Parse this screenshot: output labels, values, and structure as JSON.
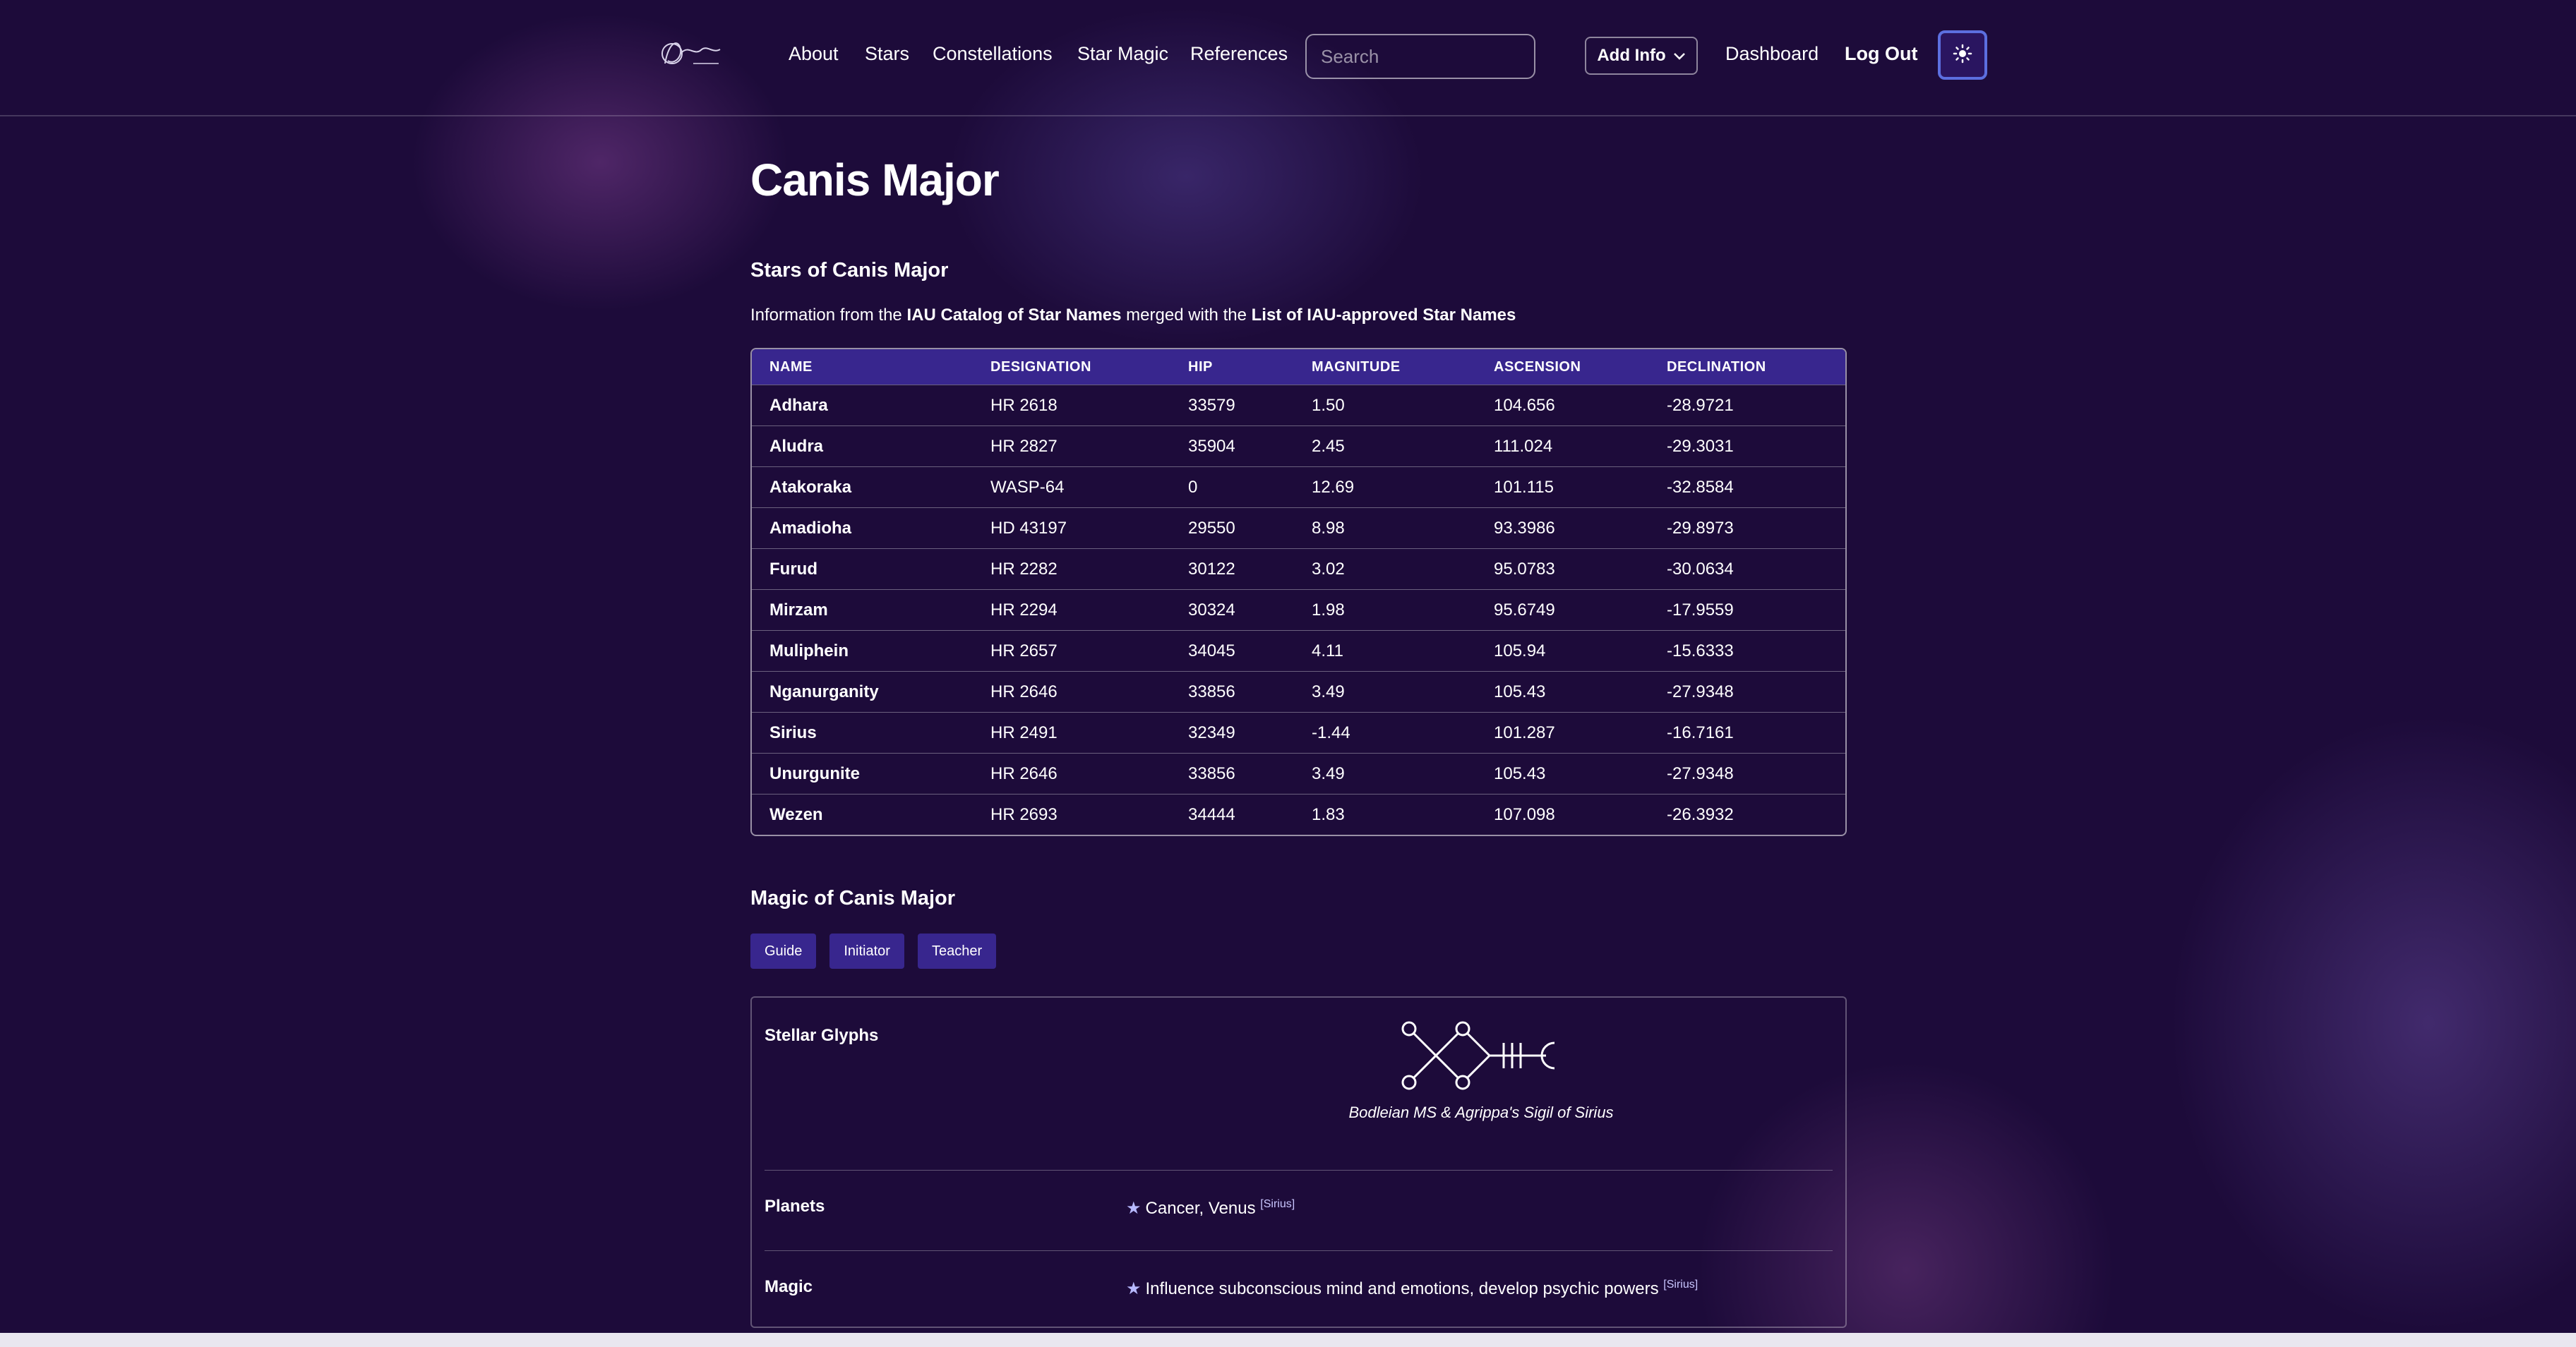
{
  "nav": {
    "logo_alt": "Adhara Starwick",
    "links": [
      "About",
      "Stars",
      "Constellations",
      "Star Magic",
      "References"
    ],
    "search_placeholder": "Search",
    "add_info": "Add Info",
    "dashboard": "Dashboard",
    "logout": "Log Out",
    "theme_icon": "sun-icon"
  },
  "page": {
    "title": "Canis Major",
    "stars_heading": "Stars of Canis Major",
    "intro_pre": "Information from the ",
    "intro_src1": "IAU Catalog of Star Names",
    "intro_mid": " merged with the ",
    "intro_src2": "List of IAU-approved Star Names"
  },
  "table": {
    "headers": [
      "NAME",
      "DESIGNATION",
      "HIP",
      "MAGNITUDE",
      "ASCENSION",
      "DECLINATION"
    ],
    "rows": [
      [
        "Adhara",
        "HR 2618",
        "33579",
        "1.50",
        "104.656",
        "-28.9721"
      ],
      [
        "Aludra",
        "HR 2827",
        "35904",
        "2.45",
        "111.024",
        "-29.3031"
      ],
      [
        "Atakoraka",
        "WASP-64",
        "0",
        "12.69",
        "101.115",
        "-32.8584"
      ],
      [
        "Amadioha",
        "HD 43197",
        "29550",
        "8.98",
        "93.3986",
        "-29.8973"
      ],
      [
        "Furud",
        "HR 2282",
        "30122",
        "3.02",
        "95.0783",
        "-30.0634"
      ],
      [
        "Mirzam",
        "HR 2294",
        "30324",
        "1.98",
        "95.6749",
        "-17.9559"
      ],
      [
        "Muliphein",
        "HR 2657",
        "34045",
        "4.11",
        "105.94",
        "-15.6333"
      ],
      [
        "Nganurganity",
        "HR 2646",
        "33856",
        "3.49",
        "105.43",
        "-27.9348"
      ],
      [
        "Sirius",
        "HR 2491",
        "32349",
        "-1.44",
        "101.287",
        "-16.7161"
      ],
      [
        "Unurgunite",
        "HR 2646",
        "33856",
        "3.49",
        "105.43",
        "-27.9348"
      ],
      [
        "Wezen",
        "HR 2693",
        "34444",
        "1.83",
        "107.098",
        "-26.3932"
      ]
    ]
  },
  "magic": {
    "heading": "Magic of Canis Major",
    "tags": [
      "Guide",
      "Initiator",
      "Teacher"
    ],
    "glyphs_label": "Stellar Glyphs",
    "glyph_caption": "Bodleian MS & Agrippa's Sigil of Sirius",
    "planets_label": "Planets",
    "planets_value": "Cancer, Venus",
    "planets_ref": "[Sirius]",
    "magic_label": "Magic",
    "magic_value": "Influence subconscious mind and emotions, develop psychic powers",
    "magic_ref": "[Sirius]"
  },
  "colors": {
    "background": "#1d0b3a",
    "header_row": "#38268e",
    "accent_border": "#5c6fe0"
  }
}
